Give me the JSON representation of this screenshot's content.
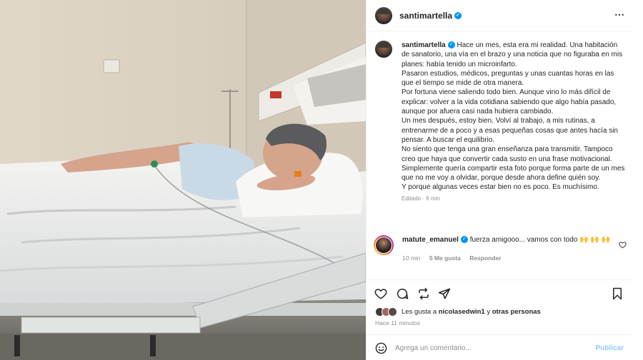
{
  "post": {
    "username": "santimartella",
    "more_icon": "⋯",
    "caption_paragraphs": [
      "Hace un mes, esta era mi realidad. Una habitación de sanatorio, una vía en el brazo y una noticia que no figuraba en mis planes: había tenido un microinfarto.",
      "Pasaron estudios, médicos, preguntas y unas cuantas horas en las que el tiempo se mide de otra manera.",
      "Por fortuna viene saliendo todo bien. Aunque vino lo más difícil de explicar: volver a la vida cotidiana sabiendo que algo había pasado, aunque por afuera casi nada hubiera cambiado.",
      "Un mes después, estoy bien. Volví al trabajo, a mis rutinas, a entrenarme de a poco y a esas pequeñas cosas que antes hacía sin pensar. A buscar el equilibrio.",
      "No siento que tenga una gran enseñanza para transmitir. Tampoco creo que haya que convertir cada susto en una frase motivacional.",
      "Simplemente quería compartir esta foto porque forma parte de un mes que no me voy a olvidar, porque desde ahora define quién soy.",
      "Y porque algunas veces estar bien no es poco. Es muchísimo."
    ],
    "edited_label": "Editado · 6 min"
  },
  "comment": {
    "username": "matute_emanuel",
    "text": "fuerza amigooo... vamos con todo 🙌 🙌 🙌",
    "time": "10 min",
    "likes": "5 Me gusta",
    "reply": "Responder"
  },
  "likes": {
    "prefix": "Les gusta a",
    "user": "nicolasedwin1",
    "middle": "y",
    "others": "otras personas"
  },
  "timestamp": "Hace 11 minutos",
  "add_comment": {
    "placeholder": "Agrega un comentario...",
    "publish_label": "Publicar"
  },
  "colors": {
    "verified": "#0095f6",
    "publish": "#8fc7f7",
    "meta_gray": "#8e8e8e",
    "text": "#262626"
  },
  "icons": [
    "heart-icon",
    "comment-icon",
    "repost-icon",
    "share-icon",
    "bookmark-icon",
    "emoji-icon",
    "verified-icon",
    "more-icon"
  ]
}
